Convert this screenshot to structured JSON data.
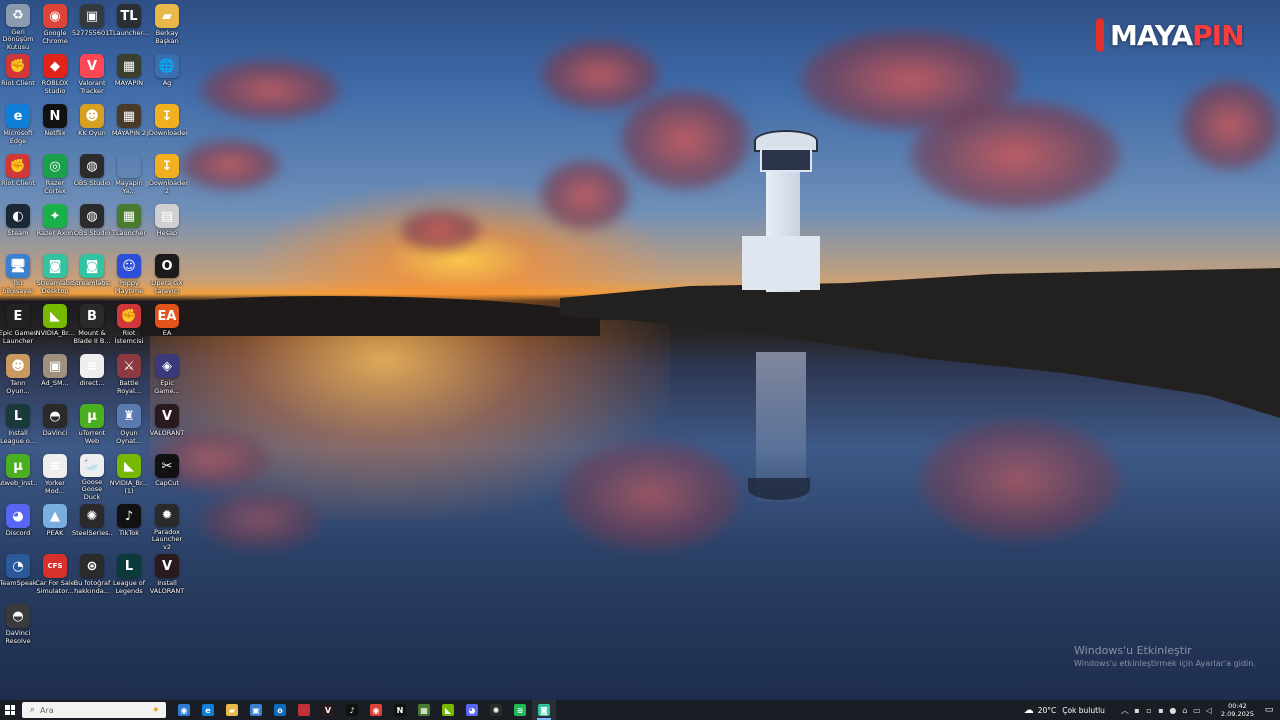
{
  "wallpaper": {
    "logo_prefix": "MAYA",
    "logo_suffix": "PIN",
    "activation_title": "Windows'u Etkinleştir",
    "activation_subtitle": "Windows'u etkinleştirmek için Ayarlar'a gidin."
  },
  "desktop": {
    "icons": [
      {
        "label": "Geri\nDönüşüm\nKutusu",
        "icon": "recycle-bin-icon",
        "glyph": "♻",
        "color": "#8a9bb0"
      },
      {
        "label": "Google\nChrome",
        "icon": "chrome-icon",
        "glyph": "◉",
        "color": "#db4437"
      },
      {
        "label": "527755601...",
        "icon": "image-file-icon",
        "glyph": "▣",
        "color": "#333a40"
      },
      {
        "label": "TLauncher-...",
        "icon": "tlauncher-icon",
        "glyph": "TL",
        "color": "#2b2f33"
      },
      {
        "label": "Berkay\nBaşkan",
        "icon": "folder-icon",
        "glyph": "▰",
        "color": "#e8b84a"
      },
      {
        "label": "Riot Client",
        "icon": "riot-client-icon",
        "glyph": "✊",
        "color": "#d13639"
      },
      {
        "label": "ROBLOX\nStudio",
        "icon": "roblox-studio-icon",
        "glyph": "◆",
        "color": "#e2231a"
      },
      {
        "label": "Valorant\nTracker",
        "icon": "valorant-tracker-icon",
        "glyph": "V",
        "color": "#ff4655"
      },
      {
        "label": "MAYAPIN",
        "icon": "minecraft-icon",
        "glyph": "▦",
        "color": "#3a3f30"
      },
      {
        "label": "Ag",
        "icon": "network-icon",
        "glyph": "🌐",
        "color": "#3a6fb0"
      },
      {
        "label": "Microsoft\nEdge",
        "icon": "edge-icon",
        "glyph": "e",
        "color": "#0f7fd8"
      },
      {
        "label": "Netflix",
        "icon": "netflix-icon",
        "glyph": "N",
        "color": "#111"
      },
      {
        "label": "KK Oyun",
        "icon": "game-icon",
        "glyph": "☻",
        "color": "#d8a020"
      },
      {
        "label": "MAYAPIN 2",
        "icon": "minecraft-icon",
        "glyph": "▦",
        "color": "#4a3a2a"
      },
      {
        "label": "JDownloader",
        "icon": "jdownloader-icon",
        "glyph": "↧",
        "color": "#f0b020"
      },
      {
        "label": "Riot Client",
        "icon": "riot-client-icon",
        "glyph": "✊",
        "color": "#d13639"
      },
      {
        "label": "Razer Cortex",
        "icon": "razer-cortex-icon",
        "glyph": "◎",
        "color": "#1aa04a"
      },
      {
        "label": "OBS Studio",
        "icon": "obs-icon",
        "glyph": "◍",
        "color": "#2b2b2b"
      },
      {
        "label": "Mayapin Ya...",
        "icon": "text-file-icon",
        "glyph": "",
        "color": "rgba(0,0,0,0)"
      },
      {
        "label": "JDownloader\n2",
        "icon": "jdownloader-icon",
        "glyph": "↧",
        "color": "#f0b020"
      },
      {
        "label": "Steam",
        "icon": "steam-icon",
        "glyph": "◐",
        "color": "#1b2838"
      },
      {
        "label": "Razer Axon",
        "icon": "razer-axon-icon",
        "glyph": "✦",
        "color": "#1ab04a"
      },
      {
        "label": "OBS Studio",
        "icon": "obs-icon",
        "glyph": "◍",
        "color": "#2b2b2b"
      },
      {
        "label": "TLauncher",
        "icon": "tlauncher-icon",
        "glyph": "▦",
        "color": "#4a7a30"
      },
      {
        "label": "Hesap",
        "icon": "calculator-icon",
        "glyph": "▤",
        "color": "#d0d0d0"
      },
      {
        "label": "Bu bilgisayar",
        "icon": "this-pc-icon",
        "glyph": "🖥",
        "color": "#3a7fd0"
      },
      {
        "label": "Streamlabs\nDesktop",
        "icon": "streamlabs-icon",
        "glyph": "◙",
        "color": "#31c3a2"
      },
      {
        "label": "Streamlabs...",
        "icon": "streamlabs-icon",
        "glyph": "◙",
        "color": "#31c3a2"
      },
      {
        "label": "Poppy\nPlaytime",
        "icon": "poppy-playtime-icon",
        "glyph": "☺",
        "color": "#2b4fd8"
      },
      {
        "label": "Opera GX\ntarayıcı",
        "icon": "opera-gx-icon",
        "glyph": "O",
        "color": "#1b1b1b"
      },
      {
        "label": "Epic Games\nLauncher",
        "icon": "epic-games-icon",
        "glyph": "E",
        "color": "#222"
      },
      {
        "label": "NVIDIA_Br...",
        "icon": "nvidia-icon",
        "glyph": "◣",
        "color": "#76b900"
      },
      {
        "label": "Mount &\nBlade II B...",
        "icon": "mount-blade-icon",
        "glyph": "B",
        "color": "#2a2a2a"
      },
      {
        "label": "Riot İstemcisi",
        "icon": "riot-client-icon",
        "glyph": "✊",
        "color": "#d13639"
      },
      {
        "label": "EA",
        "icon": "ea-icon",
        "glyph": "EA",
        "color": "#e2521a"
      },
      {
        "label": "Tanrı Oyun...",
        "icon": "game-icon",
        "glyph": "☻",
        "color": "#c89a60"
      },
      {
        "label": "Ad_SM...",
        "icon": "image-file-icon",
        "glyph": "▣",
        "color": "#a09080"
      },
      {
        "label": "direct...",
        "icon": "text-file-icon",
        "glyph": "≡",
        "color": "#eeeeee"
      },
      {
        "label": "Battle Royal...",
        "icon": "game-icon",
        "glyph": "⚔",
        "color": "#8a3a40"
      },
      {
        "label": "Epic Game...",
        "icon": "game-icon",
        "glyph": "◈",
        "color": "#3a3a7a"
      },
      {
        "label": "Install\nLeague o...",
        "icon": "league-of-legends-icon",
        "glyph": "L",
        "color": "#1a3a3a"
      },
      {
        "label": "DaVinci",
        "icon": "davinci-icon",
        "glyph": "◓",
        "color": "#2a2a2a"
      },
      {
        "label": "uTorrent Web",
        "icon": "utorrent-icon",
        "glyph": "µ",
        "color": "#4ab020"
      },
      {
        "label": "Oyun Oynat...",
        "icon": "game-icon",
        "glyph": "♜",
        "color": "#5a7ab0"
      },
      {
        "label": "VALORANT",
        "icon": "valorant-icon",
        "glyph": "V",
        "color": "#2a1a1e"
      },
      {
        "label": "utweb_inst...",
        "icon": "utorrent-icon",
        "glyph": "µ",
        "color": "#4ab020"
      },
      {
        "label": "Yorker Mod...",
        "icon": "text-file-icon",
        "glyph": "≡",
        "color": "#eeeeee"
      },
      {
        "label": "Goose Goose\nDuck",
        "icon": "goose-goose-duck-icon",
        "glyph": "🦢",
        "color": "#eeeeee"
      },
      {
        "label": "NVIDIA_Br...\n(1)",
        "icon": "nvidia-icon",
        "glyph": "◣",
        "color": "#76b900"
      },
      {
        "label": "CapCut",
        "icon": "capcut-icon",
        "glyph": "✂",
        "color": "#111"
      },
      {
        "label": "Discord",
        "icon": "discord-icon",
        "glyph": "◕",
        "color": "#5865f2"
      },
      {
        "label": "PEAK",
        "icon": "peak-icon",
        "glyph": "▲",
        "color": "#7aaee0"
      },
      {
        "label": "SteelSeries...",
        "icon": "steelseries-icon",
        "glyph": "✺",
        "color": "#2a2a2a"
      },
      {
        "label": "TikTok",
        "icon": "tiktok-icon",
        "glyph": "♪",
        "color": "#111"
      },
      {
        "label": "Paradox\nLauncher v2",
        "icon": "paradox-icon",
        "glyph": "✹",
        "color": "#2a2a2a"
      },
      {
        "label": "TeamSpeak",
        "icon": "teamspeak-icon",
        "glyph": "◔",
        "color": "#2a5a9a"
      },
      {
        "label": "Car For Sale\nSimulator...",
        "icon": "car-for-sale-icon",
        "glyph": "CFS",
        "color": "#d8302a"
      },
      {
        "label": "Bu fotoğraf\nhakkında...",
        "icon": "about-photo-icon",
        "glyph": "⊛",
        "color": "#2a2a2a"
      },
      {
        "label": "League of\nLegends",
        "icon": "league-of-legends-icon",
        "glyph": "L",
        "color": "#0a3a3a"
      },
      {
        "label": "Install\nVALORANT",
        "icon": "valorant-icon",
        "glyph": "V",
        "color": "#2a1a1e"
      },
      {
        "label": "DaVinci\nResolve",
        "icon": "davinci-icon",
        "glyph": "◓",
        "color": "#3a3a3a"
      }
    ]
  },
  "taskbar": {
    "search_placeholder": "Ara",
    "apps": [
      {
        "icon": "chrome-icon",
        "glyph": "◉",
        "color": "#2f7fd8"
      },
      {
        "icon": "edge-icon",
        "glyph": "e",
        "color": "#0f7fd8"
      },
      {
        "icon": "file-explorer-icon",
        "glyph": "▰",
        "color": "#e8b84a"
      },
      {
        "icon": "store-icon",
        "glyph": "▣",
        "color": "#3a7fd0"
      },
      {
        "icon": "outlook-icon",
        "glyph": "o",
        "color": "#0f6cbd"
      },
      {
        "icon": "app-icon",
        "glyph": "",
        "color": "#c0303a"
      },
      {
        "icon": "valorant-icon",
        "glyph": "V",
        "color": "#2a1a1e"
      },
      {
        "icon": "tiktok-icon",
        "glyph": "♪",
        "color": "#111"
      },
      {
        "icon": "chrome-icon",
        "glyph": "◉",
        "color": "#db4437"
      },
      {
        "icon": "netflix-icon",
        "glyph": "N",
        "color": "#111"
      },
      {
        "icon": "minecraft-icon",
        "glyph": "▦",
        "color": "#4a7a30"
      },
      {
        "icon": "nvidia-icon",
        "glyph": "◣",
        "color": "#76b900"
      },
      {
        "icon": "discord-icon",
        "glyph": "◕",
        "color": "#5865f2"
      },
      {
        "icon": "steelseries-icon",
        "glyph": "✺",
        "color": "#2a2a2a"
      },
      {
        "icon": "spotify-icon",
        "glyph": "≋",
        "color": "#1db954"
      },
      {
        "icon": "streamlabs-icon",
        "glyph": "◙",
        "color": "#31c3a2"
      }
    ],
    "active_index": 15,
    "weather": {
      "temperature": "20°C",
      "condition": "Çok bulutlu"
    },
    "clock": {
      "time": "00:42",
      "date": "2.09.2025"
    }
  }
}
